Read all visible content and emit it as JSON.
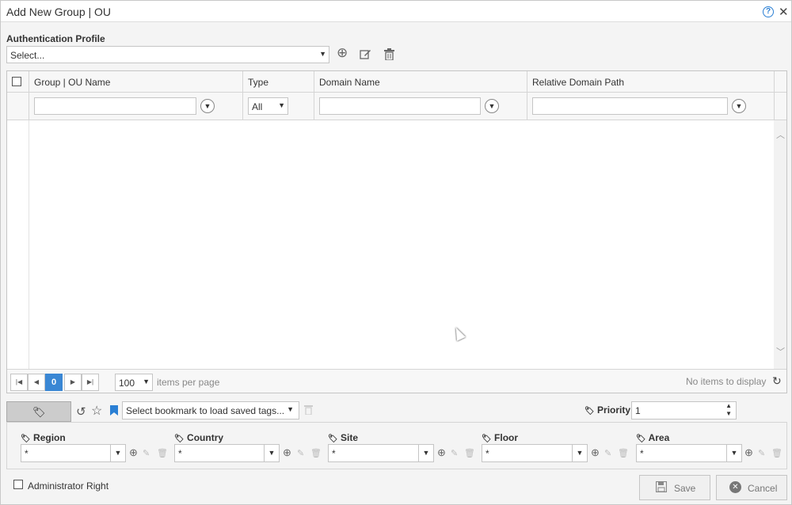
{
  "window": {
    "title": "Add New Group | OU",
    "help_icon": "?",
    "close_icon": "✕"
  },
  "auth_profile": {
    "label": "Authentication Profile",
    "value": "Select..."
  },
  "grid": {
    "columns": [
      "Group | OU Name",
      "Type",
      "Domain Name",
      "Relative Domain Path"
    ],
    "type_filter_value": "All"
  },
  "pager": {
    "current_page": "0",
    "page_size": "100",
    "items_per_page_label": "items per page",
    "empty_message": "No items to display"
  },
  "tags": {
    "bookmark_placeholder": "Select bookmark to load saved tags...",
    "priority_label": "Priority",
    "priority_value": "1",
    "fields": [
      {
        "label": "Region",
        "value": "*"
      },
      {
        "label": "Country",
        "value": "*"
      },
      {
        "label": "Site",
        "value": "*"
      },
      {
        "label": "Floor",
        "value": "*"
      },
      {
        "label": "Area",
        "value": "*"
      }
    ]
  },
  "footer": {
    "admin_right_label": "Administrator Right",
    "save_label": "Save",
    "cancel_label": "Cancel"
  }
}
